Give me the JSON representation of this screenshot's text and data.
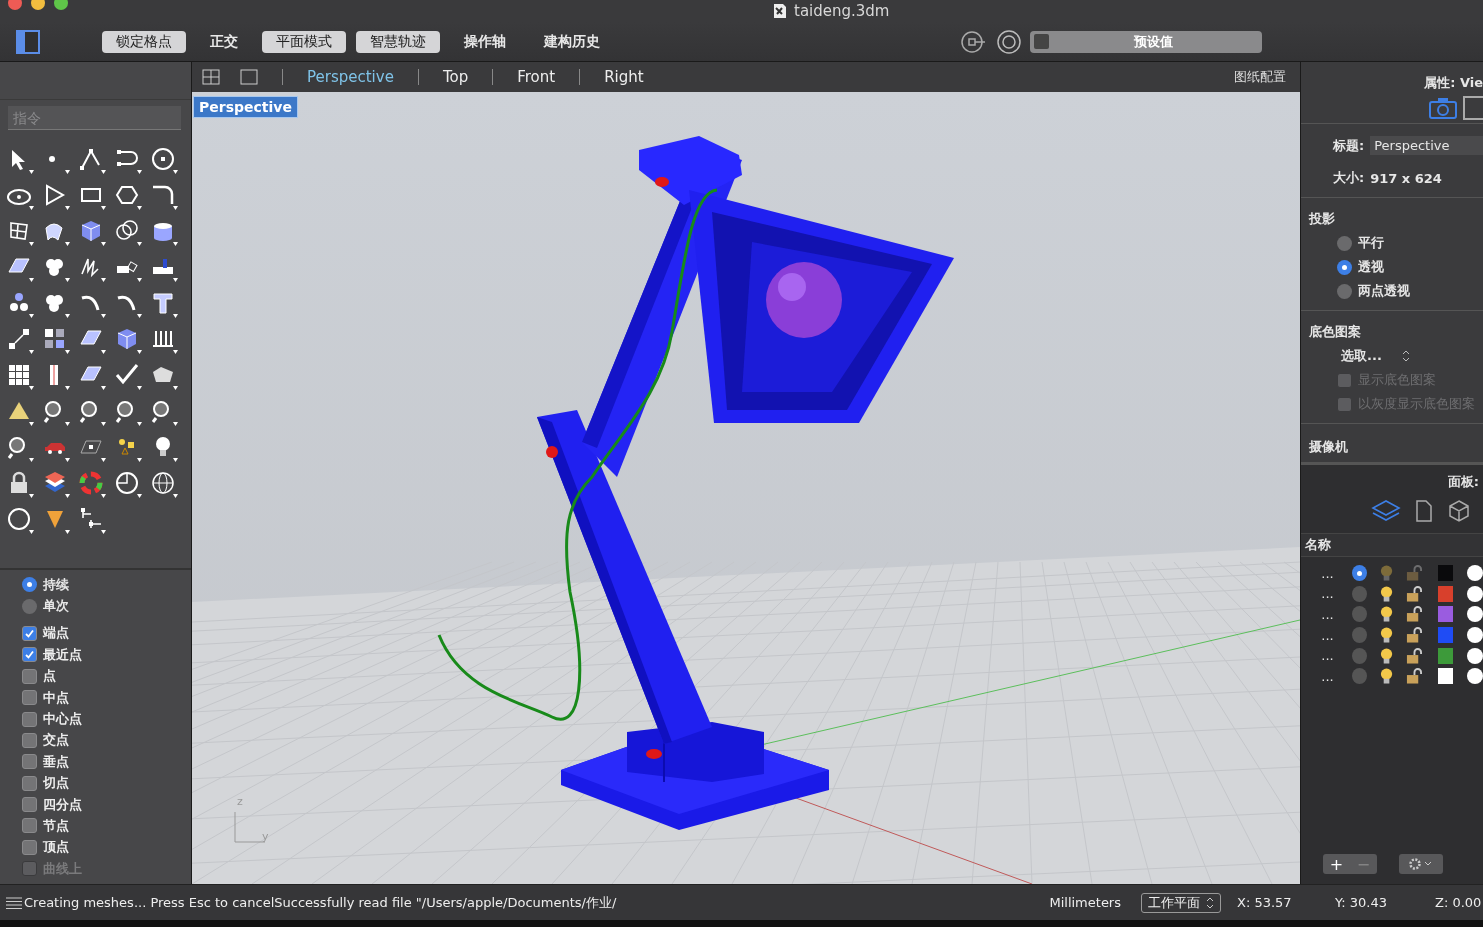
{
  "window": {
    "title": "taideng.3dm"
  },
  "toolbar": {
    "toggles": [
      {
        "label": "锁定格点",
        "on": true
      },
      {
        "label": "正交",
        "on": false
      },
      {
        "label": "平面模式",
        "on": true
      },
      {
        "label": "智慧轨迹",
        "on": true
      },
      {
        "label": "操作轴",
        "on": false
      },
      {
        "label": "建构历史",
        "on": false
      }
    ],
    "preset": "预设值"
  },
  "command": {
    "placeholder": "指令"
  },
  "osnap": {
    "modes": [
      {
        "label": "持续",
        "selected": true
      },
      {
        "label": "单次",
        "selected": false
      }
    ],
    "snaps": [
      {
        "label": "端点",
        "checked": true,
        "disabled": false
      },
      {
        "label": "最近点",
        "checked": true,
        "disabled": false
      },
      {
        "label": "点",
        "checked": false,
        "disabled": false
      },
      {
        "label": "中点",
        "checked": false,
        "disabled": false
      },
      {
        "label": "中心点",
        "checked": false,
        "disabled": false
      },
      {
        "label": "交点",
        "checked": false,
        "disabled": false
      },
      {
        "label": "垂点",
        "checked": false,
        "disabled": false
      },
      {
        "label": "切点",
        "checked": false,
        "disabled": false
      },
      {
        "label": "四分点",
        "checked": false,
        "disabled": false
      },
      {
        "label": "节点",
        "checked": false,
        "disabled": false
      },
      {
        "label": "顶点",
        "checked": false,
        "disabled": false
      },
      {
        "label": "曲线上",
        "checked": false,
        "disabled": true
      }
    ]
  },
  "viewport": {
    "tabs": [
      {
        "label": "Perspective",
        "selected": true
      },
      {
        "label": "Top",
        "selected": false
      },
      {
        "label": "Front",
        "selected": false
      },
      {
        "label": "Right",
        "selected": false
      }
    ],
    "layout_label": "图纸配置",
    "label": "Perspective",
    "axis_labels": [
      "z",
      "y"
    ]
  },
  "properties": {
    "header": "属性: Vie",
    "title_label": "标题:",
    "title_value": "Perspective",
    "size_label": "大小:",
    "size_value": "917 x 624",
    "projection": {
      "heading": "投影",
      "options": [
        {
          "label": "平行",
          "selected": false
        },
        {
          "label": "透视",
          "selected": true
        },
        {
          "label": "两点透视",
          "selected": false
        }
      ]
    },
    "background": {
      "heading": "底色图案",
      "select": "选取...",
      "options": [
        {
          "label": "显示底色图案",
          "checked": false,
          "disabled": true
        },
        {
          "label": "以灰度显示底色图案",
          "checked": false,
          "disabled": true
        }
      ]
    },
    "camera_heading": "摄像机"
  },
  "layers": {
    "header": "面板:",
    "column": "名称",
    "rows": [
      {
        "name": "...",
        "current": true,
        "color": "#0a0a0c"
      },
      {
        "name": "...",
        "current": false,
        "color": "#d8402c"
      },
      {
        "name": "...",
        "current": false,
        "color": "#9a5ce0"
      },
      {
        "name": "...",
        "current": false,
        "color": "#1f4cf5"
      },
      {
        "name": "...",
        "current": false,
        "color": "#3d9a3a"
      },
      {
        "name": "...",
        "current": false,
        "color": "#ffffff"
      }
    ],
    "add": "+",
    "remove": "−"
  },
  "status_bar": {
    "message": "Creating meshes... Press Esc to cancelSuccessfully read file \"/Users/apple/Documents/作业/",
    "units": "Millimeters",
    "cplane": "工作平面",
    "x": "X: 53.57",
    "y": "Y: 30.43",
    "z": "Z: 0.00"
  }
}
